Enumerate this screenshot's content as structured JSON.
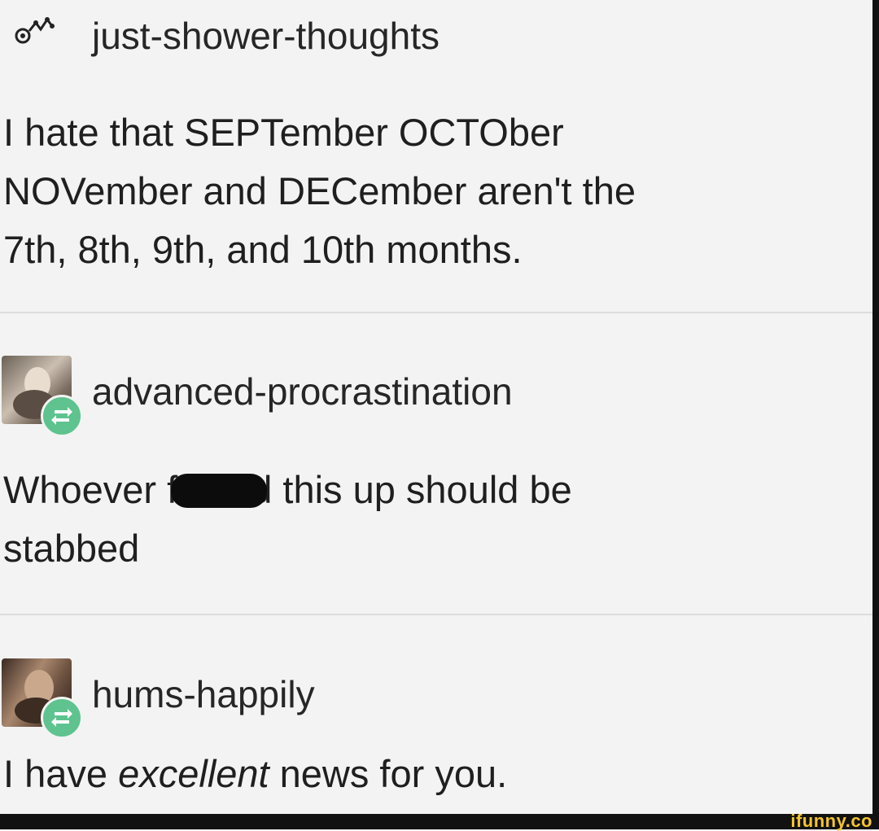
{
  "posts": [
    {
      "username": "just-shower-thoughts",
      "icon": "nodes-icon",
      "lines": [
        "I hate that SEPTember OCTOber",
        "NOVember and DECember aren't the",
        "7th, 8th, 9th, and 10th months."
      ]
    },
    {
      "username": "advanced-procrastination",
      "icon": "reblog-icon",
      "line1_before": "Whoever f",
      "line1_after": "d this up should be",
      "line2": "stabbed"
    },
    {
      "username": "hums-happily",
      "icon": "reblog-icon",
      "line_before": "I have ",
      "line_emphasis": "excellent",
      "line_after": " news for you."
    }
  ],
  "watermark": "ifunny.co",
  "colors": {
    "background": "#f3f3f3",
    "text": "#1f1f1f",
    "reblog_badge": "#5ec38e",
    "watermark": "#f4c430"
  }
}
